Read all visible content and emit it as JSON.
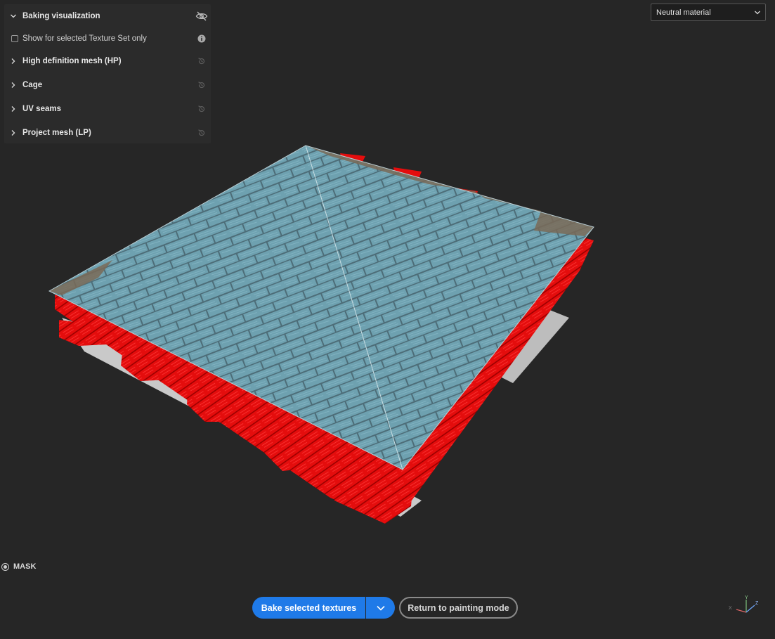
{
  "panel": {
    "title": "Baking visualization",
    "option_label": "Show for selected Texture Set only",
    "sections": [
      {
        "label": "High definition mesh (HP)"
      },
      {
        "label": "Cage"
      },
      {
        "label": "UV seams"
      },
      {
        "label": "Project mesh (LP)"
      }
    ]
  },
  "material_dropdown": {
    "selected": "Neutral material"
  },
  "mask": {
    "label": "MASK"
  },
  "actions": {
    "bake_label": "Bake selected textures",
    "return_label": "Return to painting mode"
  },
  "axis": {
    "x": "X",
    "y": "Y",
    "z": "Z"
  },
  "colors": {
    "accent": "#1f7ae8",
    "cage": "#e60a0a",
    "projection_plane": "#6ea6b8",
    "background": "#262626"
  },
  "icons": {
    "panel_visibility": "eye-off-icon",
    "option_info": "info-icon",
    "section_reset": "reset-icon",
    "dropdown": "chevron-down-icon",
    "expand": "chevron-right-icon"
  }
}
